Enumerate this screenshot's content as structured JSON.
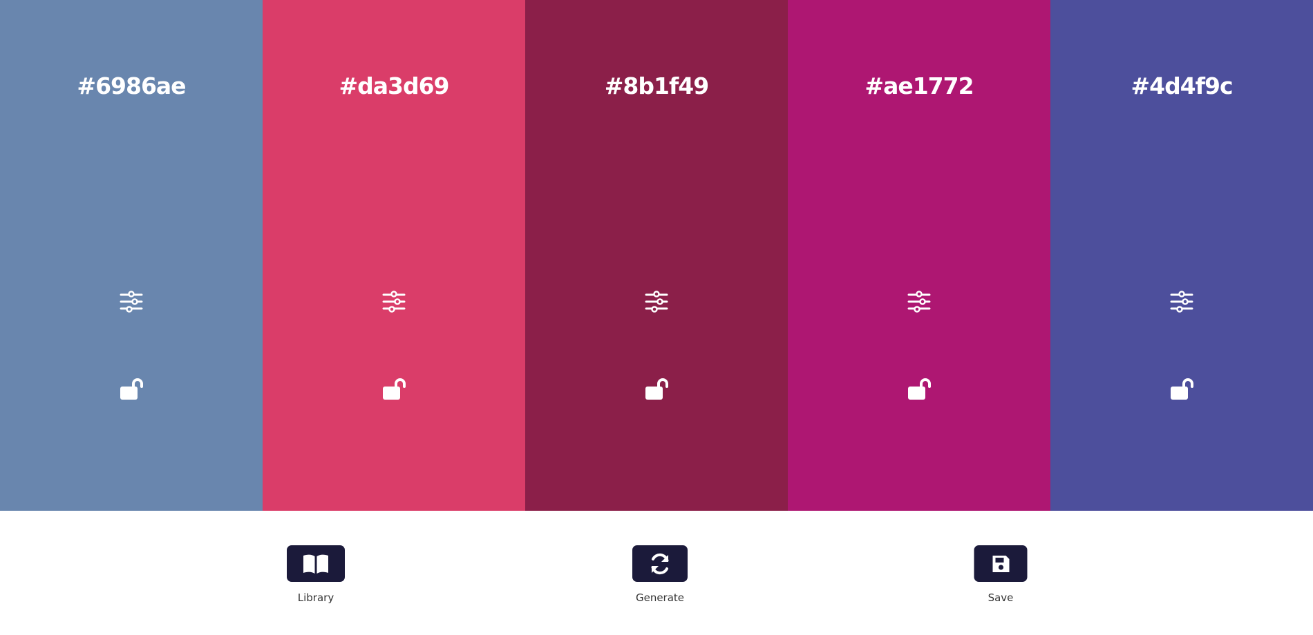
{
  "swatches": [
    {
      "hex": "#6986ae",
      "color": "#6986ae",
      "adjust_icon": "sliders-icon",
      "lock_icon": "unlock-icon"
    },
    {
      "hex": "#da3d69",
      "color": "#da3d69",
      "adjust_icon": "sliders-icon",
      "lock_icon": "unlock-icon"
    },
    {
      "hex": "#8b1f49",
      "color": "#8b1f49",
      "adjust_icon": "sliders-icon",
      "lock_icon": "unlock-icon"
    },
    {
      "hex": "#ae1772",
      "color": "#ae1772",
      "adjust_icon": "sliders-icon",
      "lock_icon": "unlock-icon"
    },
    {
      "hex": "#4d4f9c",
      "color": "#4d4f9c",
      "adjust_icon": "sliders-icon",
      "lock_icon": "unlock-icon"
    }
  ],
  "toolbar": {
    "library_label": "Library",
    "library_icon": "book-open-icon",
    "generate_label": "Generate",
    "generate_icon": "refresh-icon",
    "save_label": "Save",
    "save_icon": "floppy-disk-icon",
    "button_color": "#1b1a3a"
  }
}
